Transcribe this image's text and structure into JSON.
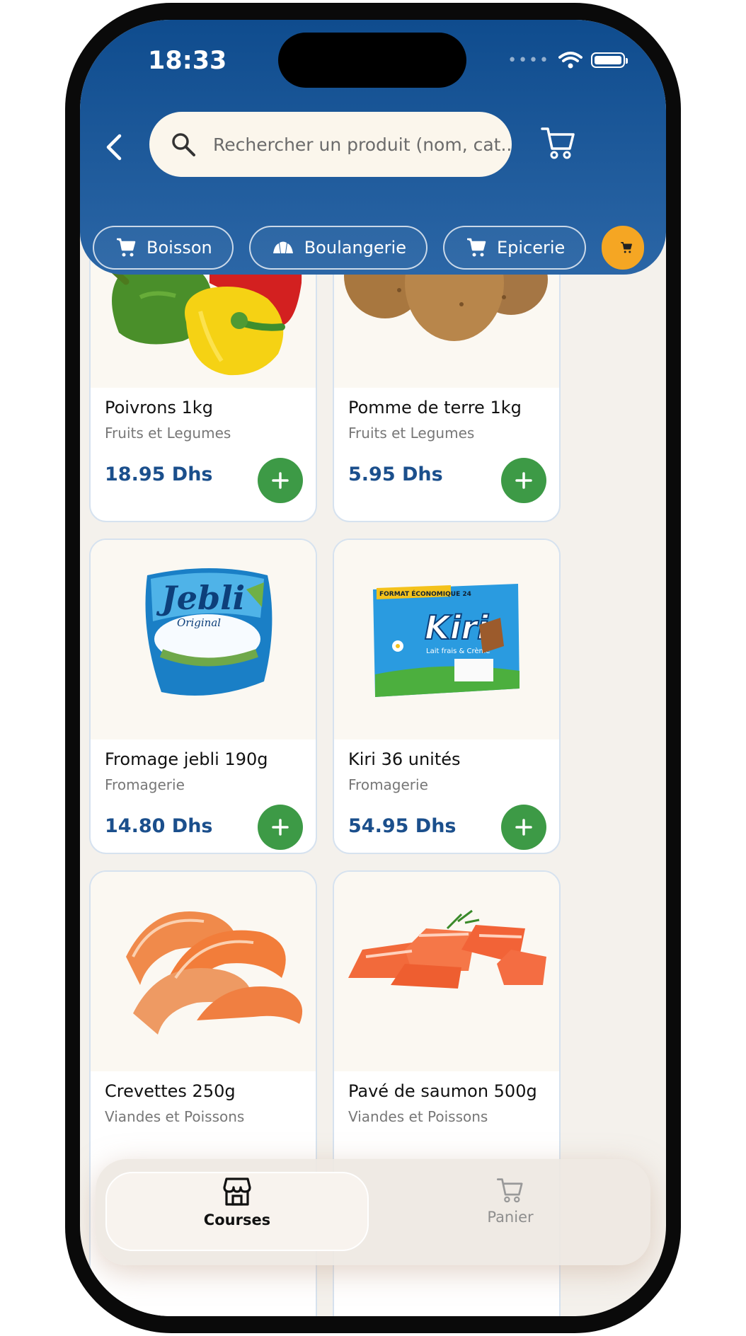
{
  "status_bar": {
    "time": "18:33"
  },
  "search": {
    "placeholder": "Rechercher un produit (nom, cat..."
  },
  "categories": [
    {
      "label": "Boisson",
      "icon": "cart-icon"
    },
    {
      "label": "Boulangerie",
      "icon": "bread-icon"
    },
    {
      "label": "Epicerie",
      "icon": "cart-icon"
    },
    {
      "label": "",
      "icon": "cart-icon",
      "color": "#f5a623"
    }
  ],
  "products": [
    {
      "name": "Poivrons 1kg",
      "category": "Fruits et Legumes",
      "price": "18.95 Dhs"
    },
    {
      "name": "Pomme de terre 1kg",
      "category": "Fruits et Legumes",
      "price": "5.95 Dhs"
    },
    {
      "name": "Fromage jebli 190g",
      "category": "Fromagerie",
      "price": "14.80 Dhs"
    },
    {
      "name": "Kiri 36 unités",
      "category": "Fromagerie",
      "price": "54.95 Dhs"
    },
    {
      "name": "Crevettes 250g",
      "category": "Viandes et Poissons",
      "price": ""
    },
    {
      "name": "Pavé de saumon 500g",
      "category": "Viandes et Poissons",
      "price": ""
    }
  ],
  "bottom_nav": {
    "courses": "Courses",
    "panier": "Panier"
  },
  "colors": {
    "header": "#0f4c8e",
    "price": "#1b4f8c",
    "add_button": "#3d9a46",
    "accent_chip": "#f5a623"
  },
  "product_images": {
    "jebli_brand": "Jebli",
    "jebli_sub": "Original",
    "kiri_brand": "Kiri",
    "kiri_badge": "FORMAT ÉCONOMIQUE 24",
    "kiri_sub": "Lait frais & Crème"
  }
}
